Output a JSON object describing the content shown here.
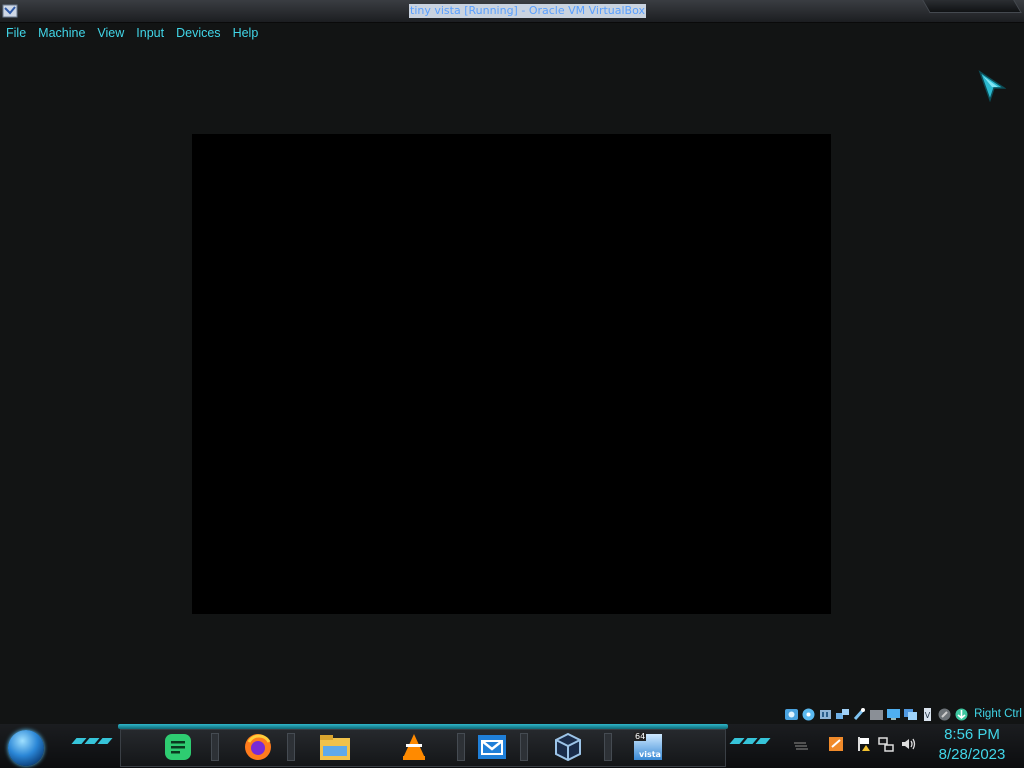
{
  "window": {
    "title": "tiny vista [Running] - Oracle VM VirtualBox"
  },
  "menu": [
    "File",
    "Machine",
    "View",
    "Input",
    "Devices",
    "Help"
  ],
  "statusbar": {
    "host_key": "Right Ctrl",
    "icons": [
      "hard-disk-icon",
      "optical-drive-icon",
      "audio-icon",
      "network-icon",
      "usb-icon",
      "shared-folders-icon",
      "display-icon",
      "video-capture-icon",
      "cpu-icon",
      "mouse-integration-icon",
      "keyboard-icon"
    ]
  },
  "taskbar": {
    "apps": [
      {
        "name": "notes-app",
        "color": "#2ecc71"
      },
      {
        "name": "firefox",
        "color": "#ff7b1c"
      },
      {
        "name": "file-explorer",
        "color": "#f1c24a"
      },
      {
        "name": "vlc",
        "color": "#ff8a00"
      },
      {
        "name": "mail",
        "color": "#1f7fd8"
      },
      {
        "name": "virtualbox",
        "color": "#9cc4e8"
      },
      {
        "name": "vista-vm",
        "badge": "64",
        "label": "vista"
      }
    ],
    "tray_icons": [
      "stack-icon",
      "update-icon",
      "action-center-flag-icon",
      "network-tray-icon",
      "volume-icon"
    ],
    "clock": {
      "time": "8:56 PM",
      "date": "8/28/2023"
    }
  },
  "colors": {
    "accent": "#41d6e8",
    "background": "#121414",
    "vm_screen": "#000000"
  }
}
